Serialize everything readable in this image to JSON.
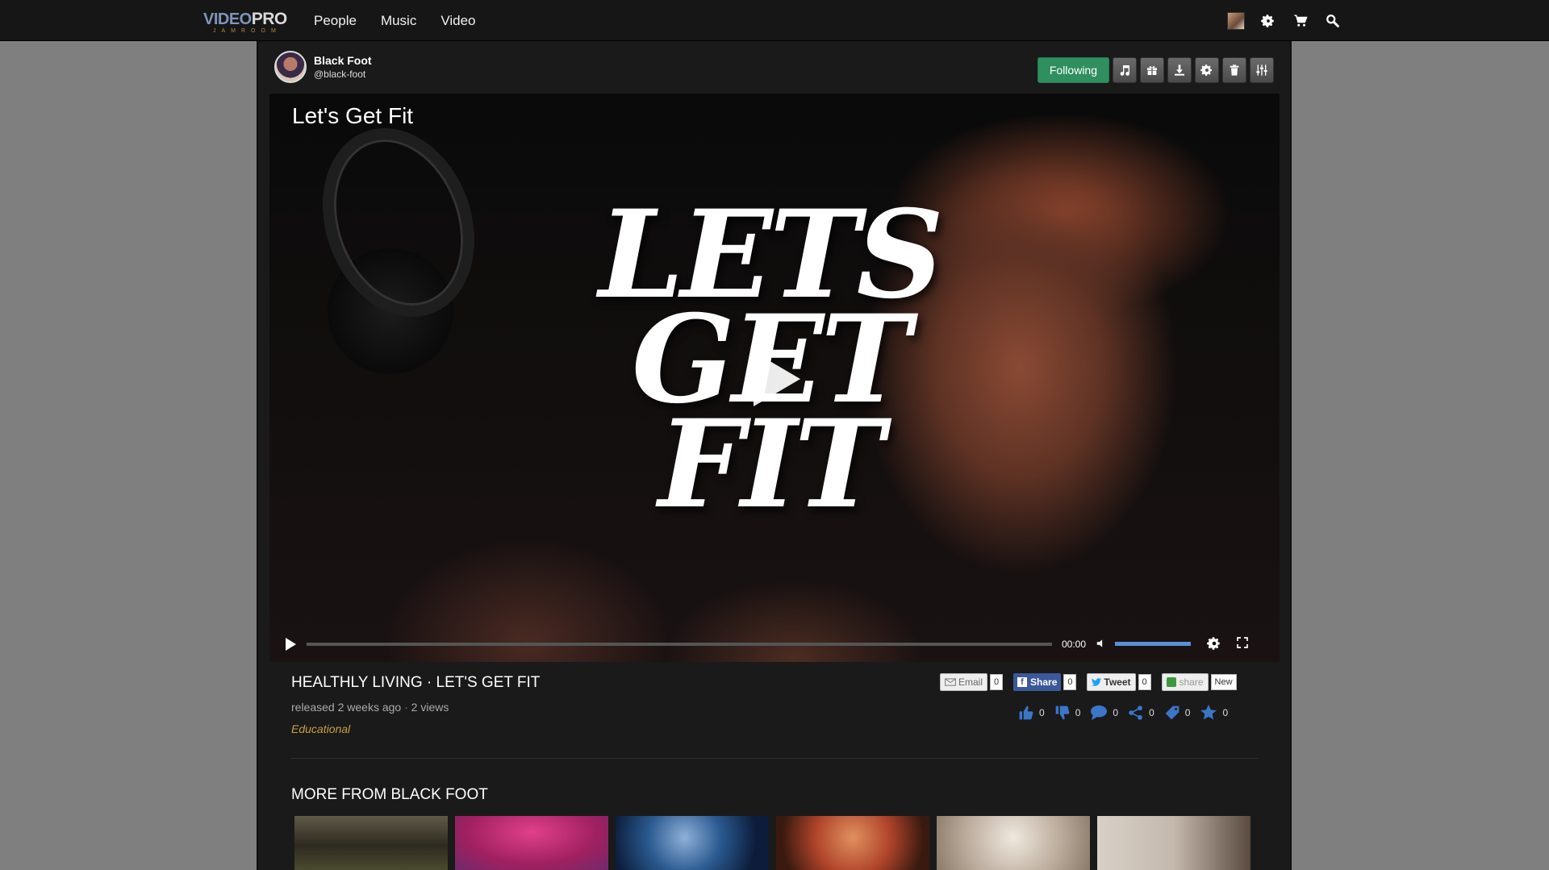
{
  "brand": {
    "top": "VIDEO",
    "top2": "PRO",
    "sub": "JAMROOM"
  },
  "nav": {
    "items": [
      {
        "label": "People"
      },
      {
        "label": "Music"
      },
      {
        "label": "Video"
      }
    ]
  },
  "profile": {
    "name": "Black Foot",
    "handle": "@black-foot"
  },
  "actions": {
    "following_label": "Following"
  },
  "video": {
    "overlay_title": "Let's Get Fit",
    "big_text": [
      "LETS",
      "GET",
      "FIT"
    ],
    "time": "00:00",
    "progress": 0,
    "volume": 1.0
  },
  "info": {
    "title": "HEALTHLY LIVING · LET'S GET FIT",
    "released": "released 2 weeks ago",
    "views": "2 views",
    "category": "Educational"
  },
  "share": {
    "email": {
      "label": "Email",
      "count": "0"
    },
    "facebook": {
      "label": "Share",
      "count": "0"
    },
    "twitter": {
      "label": "Tweet",
      "count": "0"
    },
    "share": {
      "label": "share",
      "count": "New"
    }
  },
  "reactions": {
    "like": "0",
    "dislike": "0",
    "comment": "0",
    "share": "0",
    "tag": "0",
    "rating": "0"
  },
  "more": {
    "title": "MORE FROM BLACK FOOT"
  },
  "colors": {
    "accent": "#2f8f5f",
    "icon_blue": "#3b76c9",
    "category": "#c9a040"
  }
}
